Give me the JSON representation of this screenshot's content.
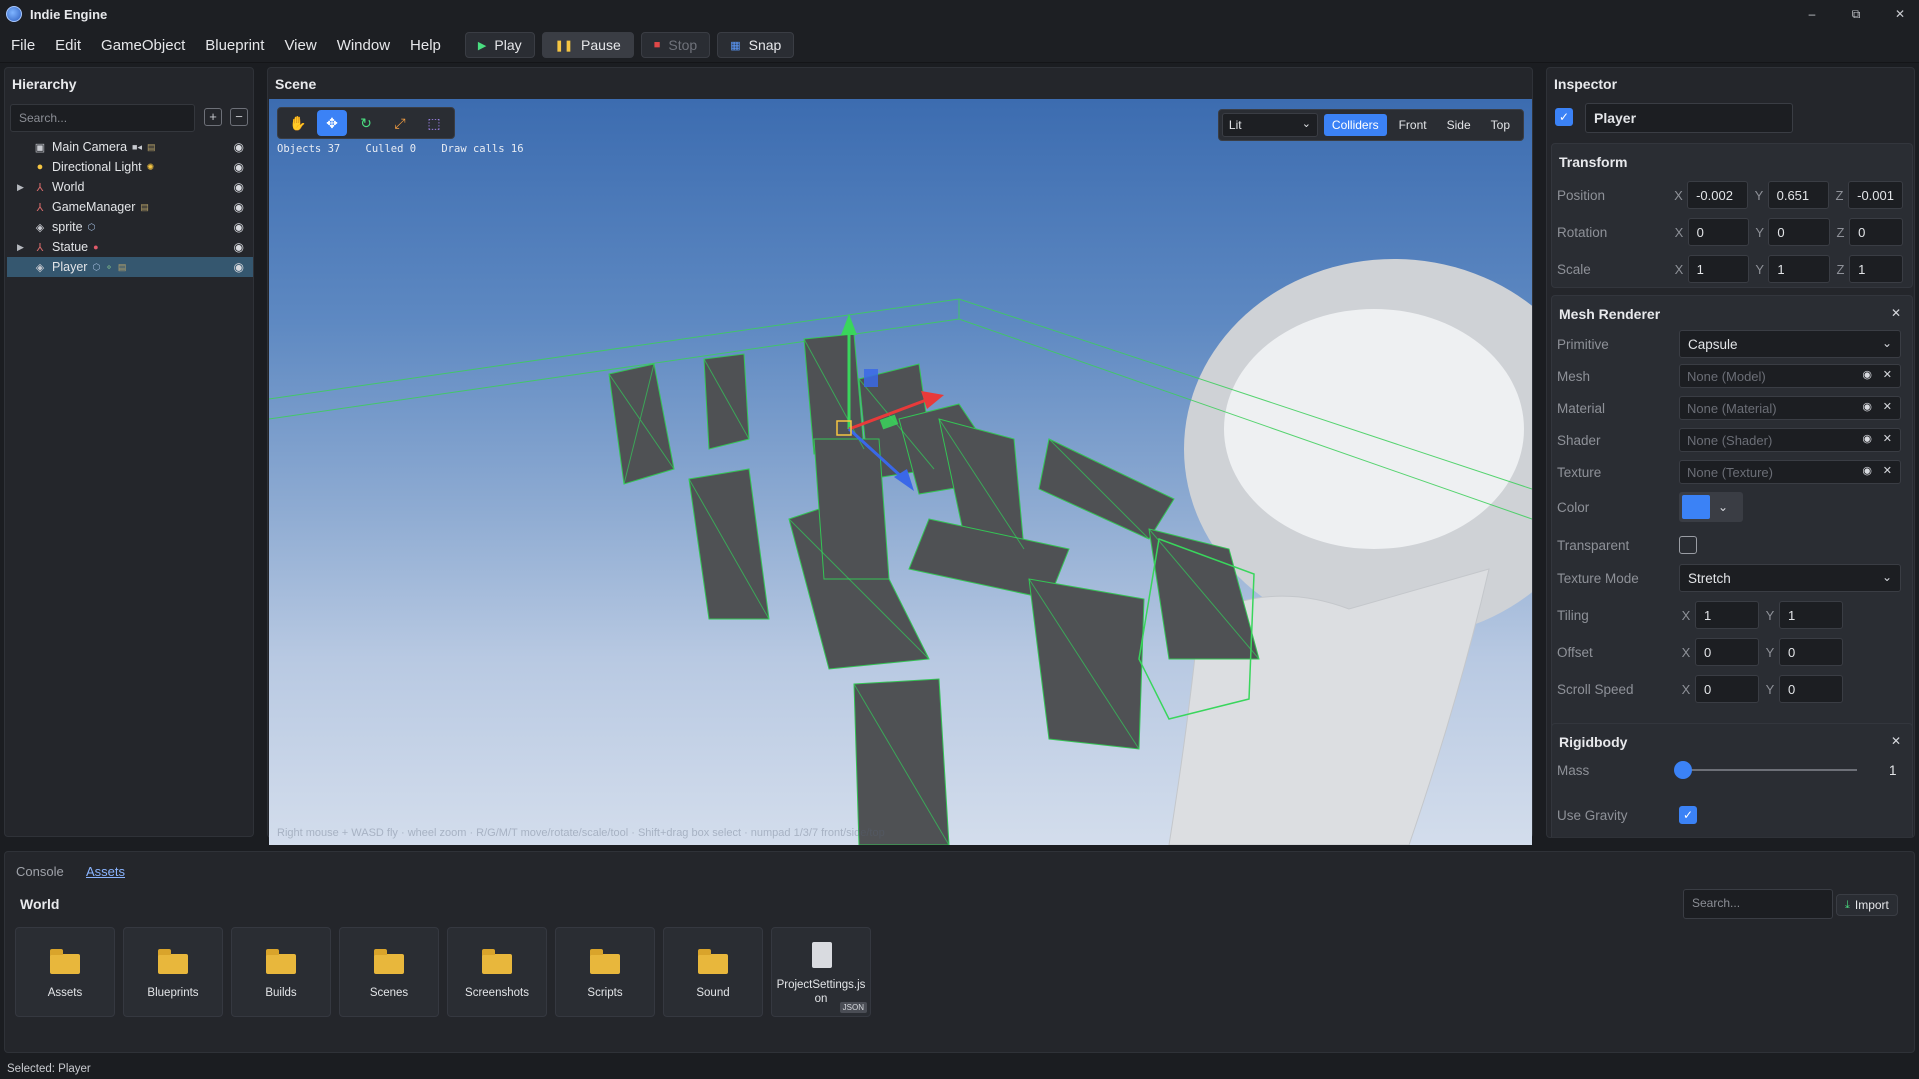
{
  "app": {
    "title": "Indie Engine"
  },
  "window_controls": {
    "minimize": "–",
    "restore": "⧉",
    "close": "✕"
  },
  "menu": [
    "File",
    "Edit",
    "GameObject",
    "Blueprint",
    "View",
    "Window",
    "Help"
  ],
  "toolbar": {
    "play": "Play",
    "pause": "Pause",
    "stop": "Stop",
    "snap": "Snap"
  },
  "hierarchy": {
    "title": "Hierarchy",
    "search_placeholder": "Search...",
    "items": [
      {
        "label": "Main Camera",
        "icon": "camera-icon"
      },
      {
        "label": "Directional Light",
        "icon": "light-icon"
      },
      {
        "label": "World",
        "icon": "axes-icon",
        "expandable": true
      },
      {
        "label": "GameManager",
        "icon": "axes-icon"
      },
      {
        "label": "sprite",
        "icon": "cube-icon"
      },
      {
        "label": "Statue",
        "icon": "axes-icon",
        "expandable": true
      },
      {
        "label": "Player",
        "icon": "cube-icon",
        "selected": true
      }
    ]
  },
  "scene": {
    "title": "Scene",
    "stats": "Objects 37    Culled 0    Draw calls 16",
    "shading": "Lit",
    "view_buttons": [
      "Colliders",
      "Front",
      "Side",
      "Top"
    ],
    "active_view": "Colliders",
    "hint": "Right mouse + WASD fly · wheel zoom · R/G/M/T move/rotate/scale/tool · Shift+drag box select · numpad 1/3/7 front/side/top"
  },
  "inspector": {
    "title": "Inspector",
    "active": true,
    "name": "Player",
    "transform": {
      "title": "Transform",
      "position": {
        "label": "Position",
        "x": "-0.002",
        "y": "0.651",
        "z": "-0.001"
      },
      "rotation": {
        "label": "Rotation",
        "x": "0",
        "y": "0",
        "z": "0"
      },
      "scale": {
        "label": "Scale",
        "x": "1",
        "y": "1",
        "z": "1"
      }
    },
    "mesh_renderer": {
      "title": "Mesh Renderer",
      "primitive_label": "Primitive",
      "primitive": "Capsule",
      "mesh_label": "Mesh",
      "mesh": "None (Model)",
      "material_label": "Material",
      "material": "None (Material)",
      "shader_label": "Shader",
      "shader": "None (Shader)",
      "texture_label": "Texture",
      "texture": "None (Texture)",
      "color_label": "Color",
      "color": "#3b82f6",
      "transparent_label": "Transparent",
      "texture_mode_label": "Texture Mode",
      "texture_mode": "Stretch",
      "tiling": {
        "label": "Tiling",
        "x": "1",
        "y": "1"
      },
      "offset": {
        "label": "Offset",
        "x": "0",
        "y": "0"
      },
      "scroll_speed": {
        "label": "Scroll Speed",
        "x": "0",
        "y": "0"
      }
    },
    "rigidbody": {
      "title": "Rigidbody",
      "mass_label": "Mass",
      "mass": "1",
      "mass_fraction": 0.02,
      "gravity_label": "Use Gravity"
    }
  },
  "bottom": {
    "tabs": [
      "Console",
      "Assets"
    ],
    "active_tab": "Assets",
    "path": "World",
    "search_placeholder": "Search...",
    "import": "Import",
    "assets": [
      {
        "label": "Assets",
        "type": "folder"
      },
      {
        "label": "Blueprints",
        "type": "folder"
      },
      {
        "label": "Builds",
        "type": "folder"
      },
      {
        "label": "Scenes",
        "type": "folder"
      },
      {
        "label": "Screenshots",
        "type": "folder"
      },
      {
        "label": "Scripts",
        "type": "folder"
      },
      {
        "label": "Sound",
        "type": "folder"
      },
      {
        "label": "ProjectSettings.json",
        "type": "file",
        "badge": "JSON"
      }
    ]
  },
  "status": "Selected: Player"
}
